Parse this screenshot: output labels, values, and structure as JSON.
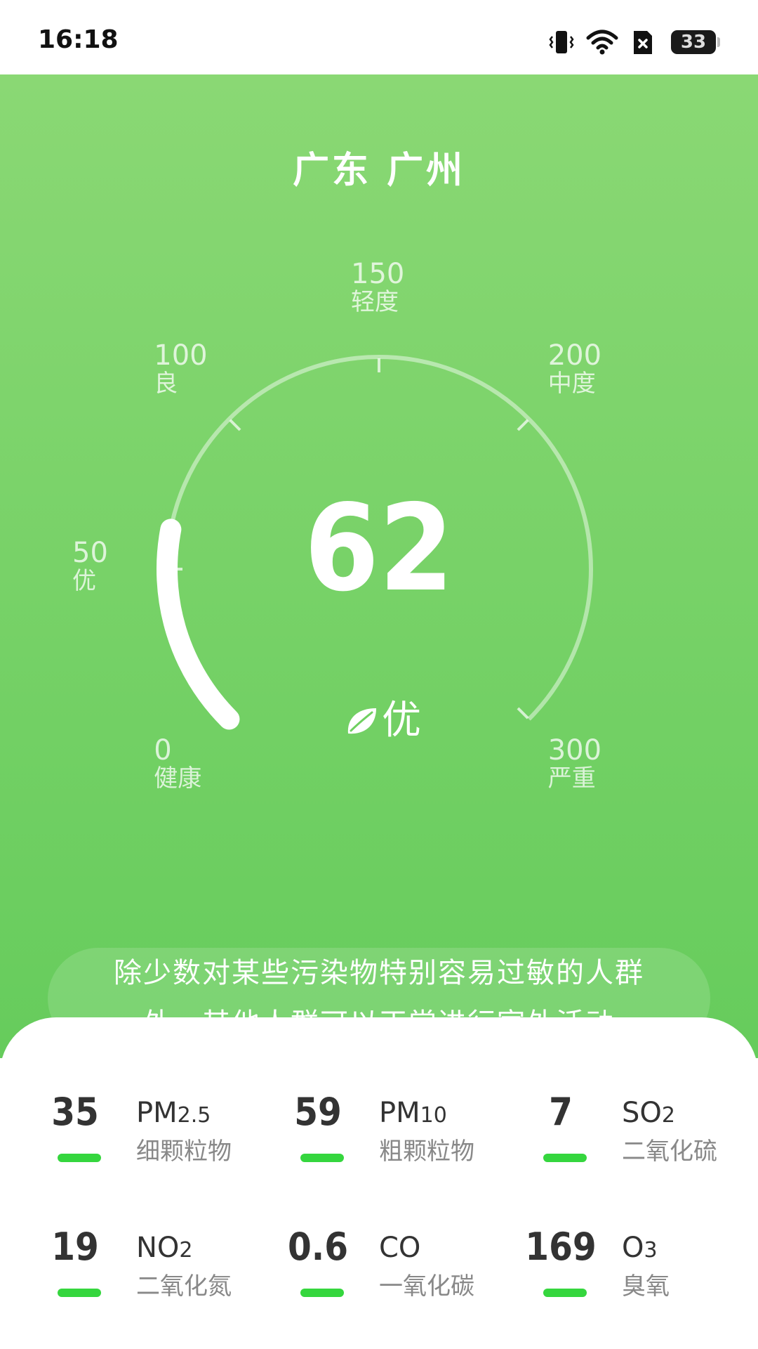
{
  "status_bar": {
    "time": "16:18",
    "battery": "33"
  },
  "header": {
    "city": "广东 广州"
  },
  "gauge": {
    "min": 0,
    "max": 300,
    "value": 62,
    "ticks": [
      {
        "value": "0",
        "level": "健康"
      },
      {
        "value": "50",
        "level": "优"
      },
      {
        "value": "100",
        "level": "良"
      },
      {
        "value": "150",
        "level": "轻度"
      },
      {
        "value": "200",
        "level": "中度"
      },
      {
        "value": "300",
        "level": "严重"
      }
    ]
  },
  "aqi": {
    "value": "62",
    "level": "优",
    "icon": "leaf-icon"
  },
  "advice": {
    "line1": "除少数对某些污染物特别容易过敏的人群",
    "line2": "外，其他人群可以正常进行室外活动"
  },
  "pollutants": [
    {
      "value": "35",
      "name": "PM",
      "sub": "2.5",
      "desc": "细颗粒物",
      "color": "#35d63e"
    },
    {
      "value": "59",
      "name": "PM",
      "sub": "10",
      "desc": "粗颗粒物",
      "color": "#35d63e"
    },
    {
      "value": "7",
      "name": "SO",
      "sub": "2",
      "desc": "二氧化硫",
      "color": "#35d63e"
    },
    {
      "value": "19",
      "name": "NO",
      "sub": "2",
      "desc": "二氧化氮",
      "color": "#35d63e"
    },
    {
      "value": "0.6",
      "name": "CO",
      "sub": "",
      "desc": "一氧化碳",
      "color": "#35d63e"
    },
    {
      "value": "169",
      "name": "O",
      "sub": "3",
      "desc": "臭氧",
      "color": "#35d63e"
    }
  ],
  "colors": {
    "accent": "#35d63e",
    "hero_top": "#8ad874",
    "hero_bottom": "#66cc5c"
  }
}
